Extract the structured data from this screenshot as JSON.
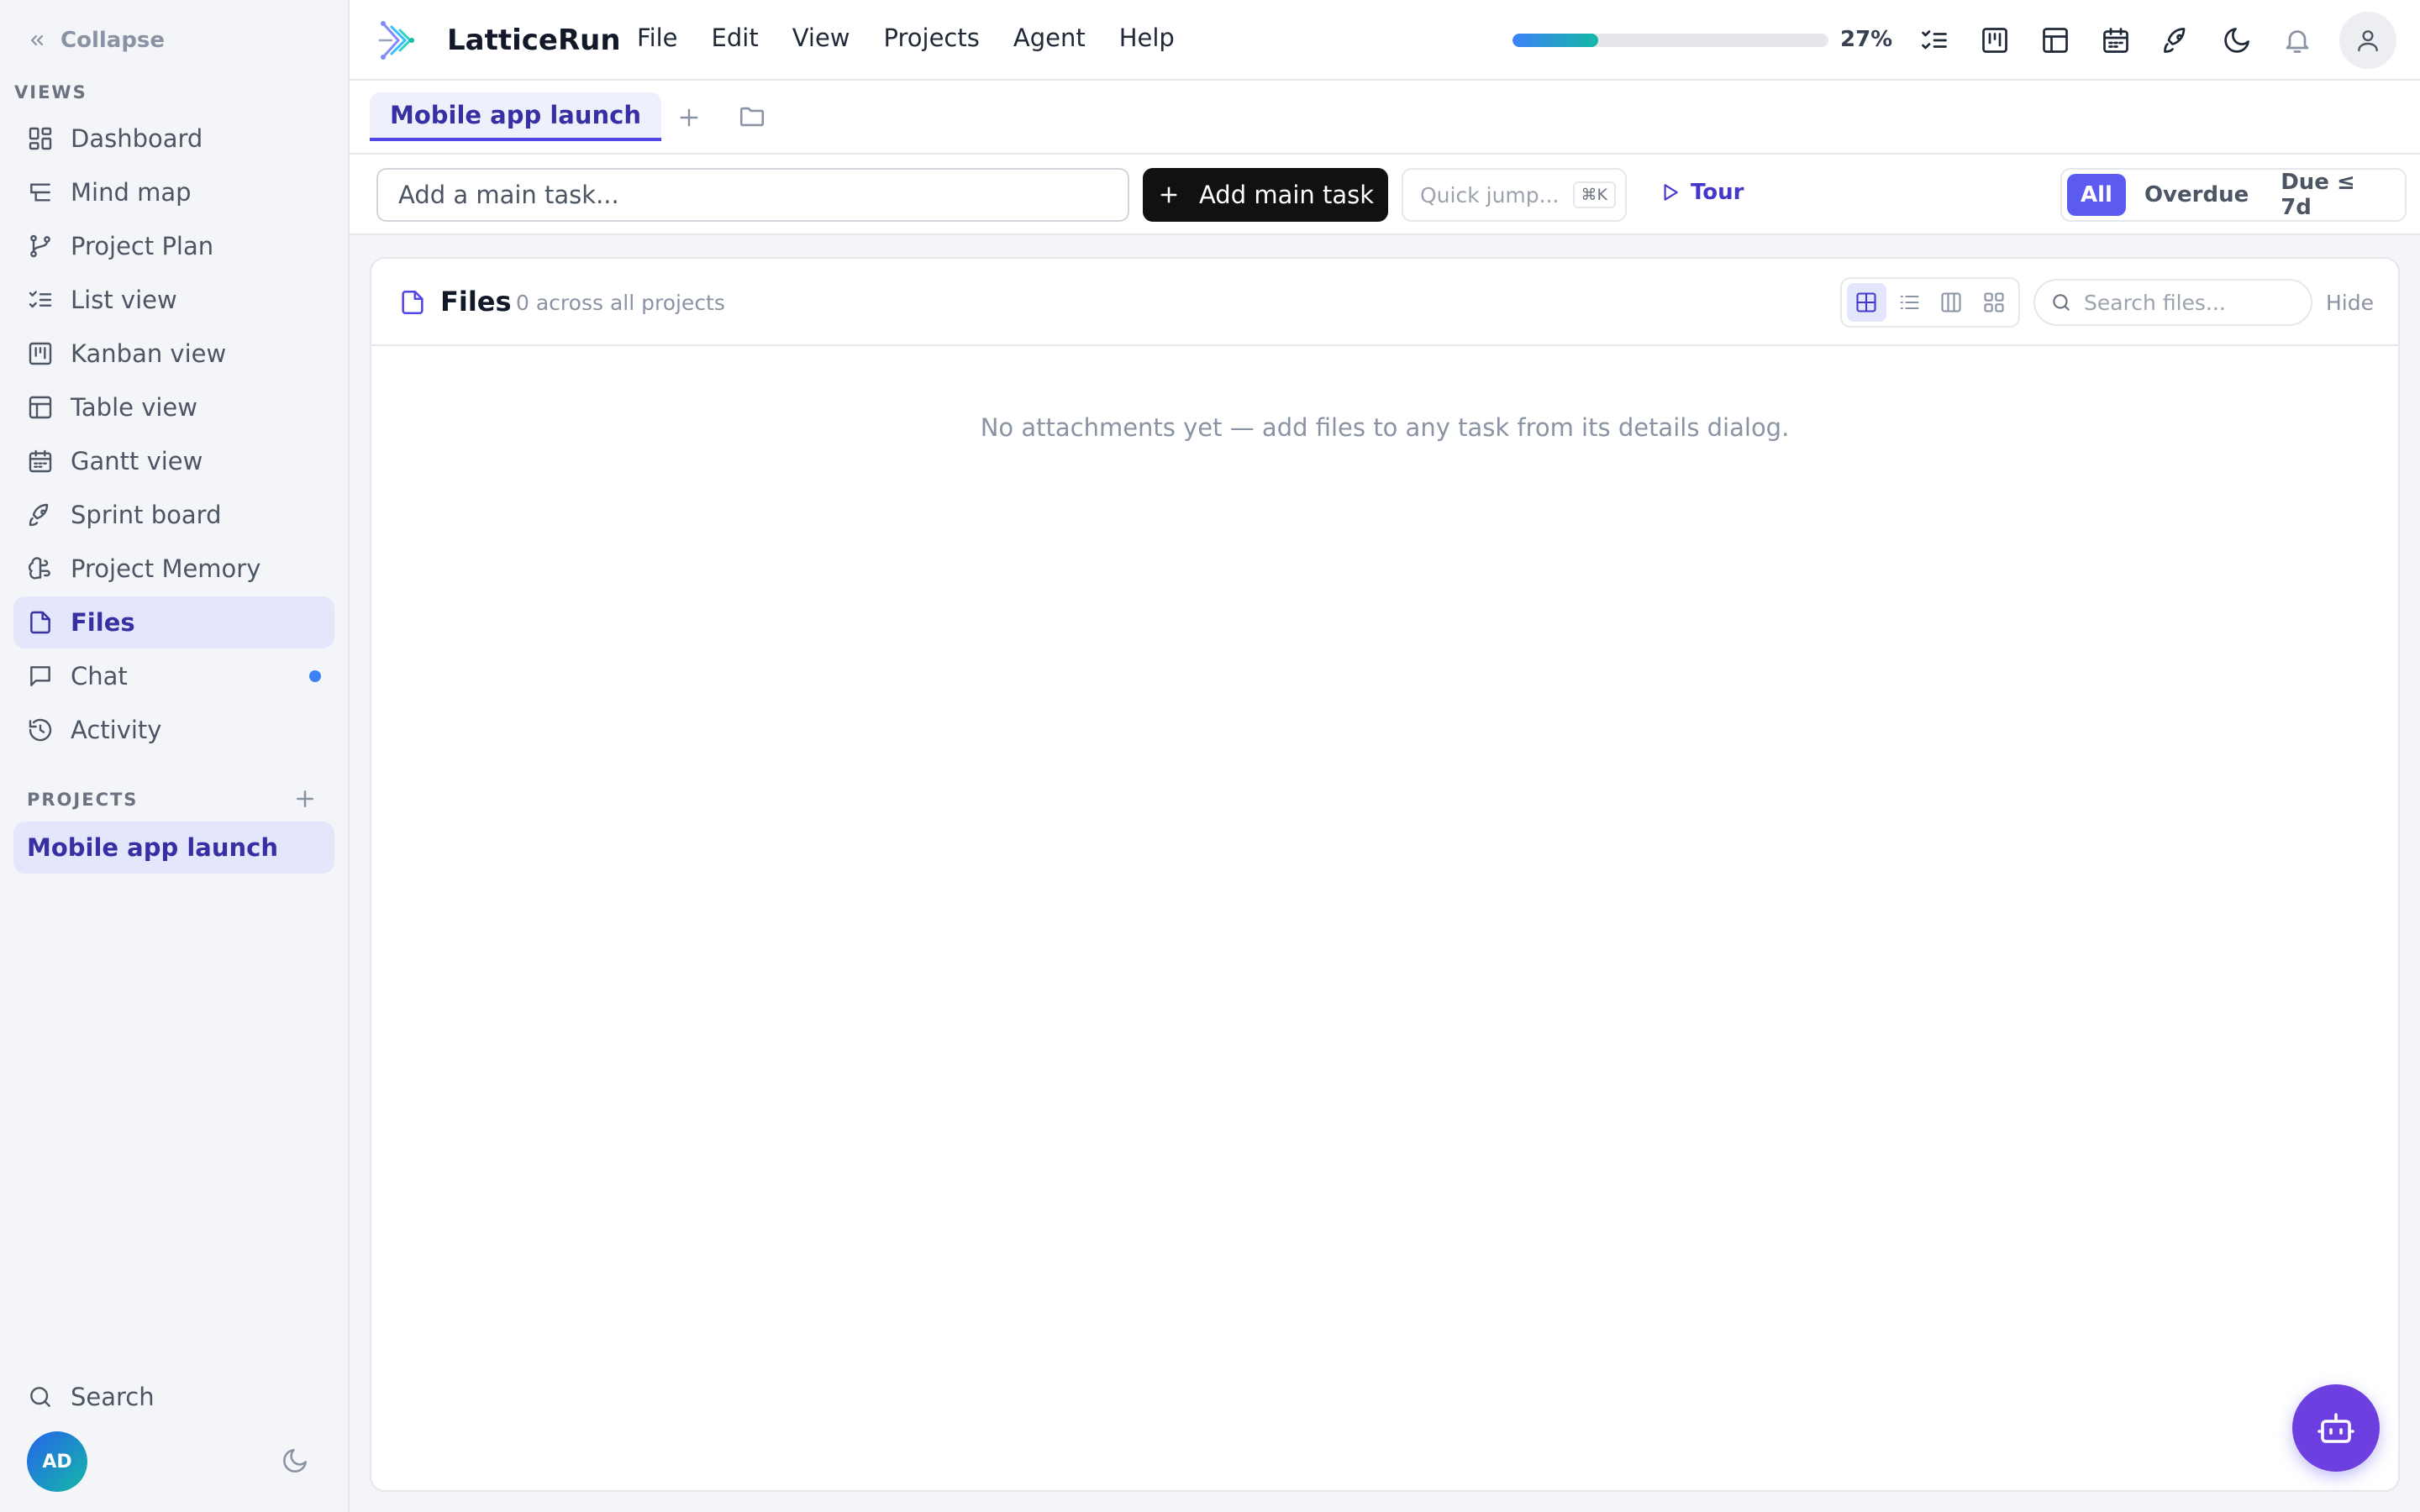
{
  "sidebar": {
    "collapse_label": "Collapse",
    "views_label": "VIEWS",
    "items": [
      {
        "label": "Dashboard",
        "icon": "dashboard-icon"
      },
      {
        "label": "Mind map",
        "icon": "mind-map-icon"
      },
      {
        "label": "Project Plan",
        "icon": "git-branch-icon"
      },
      {
        "label": "List view",
        "icon": "list-checks-icon"
      },
      {
        "label": "Kanban view",
        "icon": "kanban-icon"
      },
      {
        "label": "Table view",
        "icon": "table-icon"
      },
      {
        "label": "Gantt view",
        "icon": "calendar-icon"
      },
      {
        "label": "Sprint board",
        "icon": "rocket-icon"
      },
      {
        "label": "Project Memory",
        "icon": "brain-icon"
      },
      {
        "label": "Files",
        "icon": "file-icon",
        "active": true
      },
      {
        "label": "Chat",
        "icon": "chat-icon",
        "unread": true
      },
      {
        "label": "Activity",
        "icon": "history-icon"
      }
    ],
    "projects_label": "PROJECTS",
    "projects": [
      {
        "label": "Mobile app launch",
        "active": true
      }
    ],
    "search_label": "Search",
    "user_initials": "AD"
  },
  "topbar": {
    "brand": "LatticeRun",
    "menu": [
      "File",
      "Edit",
      "View",
      "Projects",
      "Agent",
      "Help"
    ],
    "progress_percent": 27,
    "progress_label": "27%",
    "icons": [
      "list-checks-icon",
      "kanban-icon",
      "table-icon",
      "calendar-icon",
      "rocket-icon",
      "moon-icon",
      "bell-icon",
      "user-icon"
    ]
  },
  "tabs": {
    "active_label": "Mobile app launch"
  },
  "toolbar": {
    "task_placeholder": "Add a main task...",
    "add_task_label": "Add main task",
    "quick_jump_label": "Quick jump...",
    "quick_jump_shortcut": "⌘K",
    "tour_label": "Tour",
    "filters": [
      {
        "label": "All",
        "active": true
      },
      {
        "label": "Overdue"
      },
      {
        "label": "Due ≤ 7d"
      }
    ]
  },
  "files": {
    "title": "Files",
    "count_text": "0 across all projects",
    "search_placeholder": "Search files...",
    "hide_label": "Hide",
    "empty_message": "No attachments yet — add files to any task from its details dialog."
  },
  "colors": {
    "accent": "#4f46e5",
    "active_bg": "#e4e6fb",
    "fab": "#6d3fe0",
    "unread_dot": "#3b82f6"
  }
}
